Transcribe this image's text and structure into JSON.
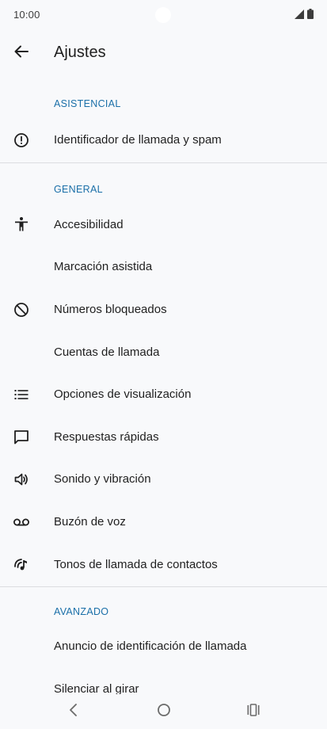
{
  "status_bar": {
    "time": "10:00",
    "icons": [
      "signal-icon",
      "battery-icon"
    ]
  },
  "app_bar": {
    "back_icon": "arrow-back-icon",
    "title": "Ajustes"
  },
  "sections": [
    {
      "header": "ASISTENCIAL",
      "items": [
        {
          "label": "Identificador de llamada y spam",
          "icon": "alert-circle-icon"
        }
      ]
    },
    {
      "header": "GENERAL",
      "items": [
        {
          "label": "Accesibilidad",
          "icon": "accessibility-icon"
        },
        {
          "label": "Marcación asistida",
          "icon": ""
        },
        {
          "label": "Números bloqueados",
          "icon": "block-icon"
        },
        {
          "label": "Cuentas de llamada",
          "icon": ""
        },
        {
          "label": "Opciones de visualización",
          "icon": "list-icon"
        },
        {
          "label": "Respuestas rápidas",
          "icon": "message-icon"
        },
        {
          "label": "Sonido y vibración",
          "icon": "volume-icon"
        },
        {
          "label": "Buzón de voz",
          "icon": "voicemail-icon"
        },
        {
          "label": "Tonos de llamada de contactos",
          "icon": "ringtone-icon"
        }
      ]
    },
    {
      "header": "AVANZADO",
      "items": [
        {
          "label": "Anuncio de identificación de llamada",
          "icon": ""
        },
        {
          "label": "Silenciar al girar",
          "icon": ""
        }
      ]
    }
  ],
  "nav_bar": {
    "icons": [
      "nav-back-icon",
      "nav-home-icon",
      "nav-recents-icon"
    ]
  },
  "colors": {
    "background": "#f8f9fb",
    "section_header": "#1a6fa8",
    "text": "#1f1f1f",
    "divider": "#dcdde0"
  }
}
